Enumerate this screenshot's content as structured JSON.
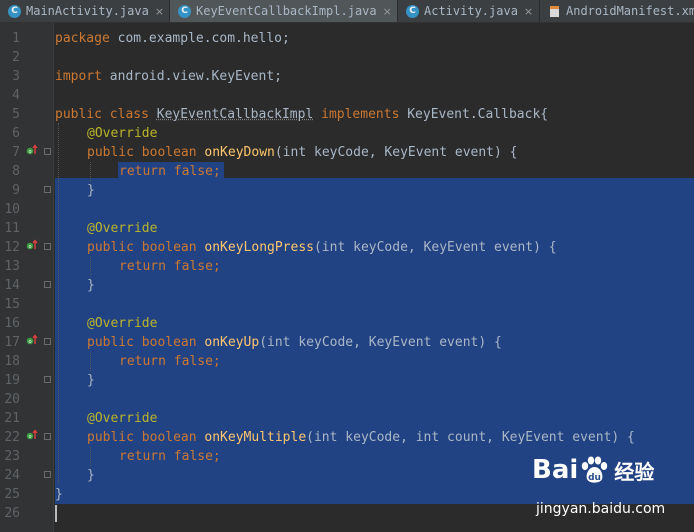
{
  "tabs": [
    {
      "label": "MainActivity.java",
      "icon": "java-class-icon",
      "icon_letter": "C",
      "active": false
    },
    {
      "label": "KeyEventCallbackImpl.java",
      "icon": "java-class-icon",
      "icon_letter": "C",
      "active": true
    },
    {
      "label": "Activity.java",
      "icon": "java-class-icon",
      "icon_letter": "C",
      "active": false
    },
    {
      "label": "AndroidManifest.xm",
      "icon": "xml-file-icon",
      "icon_letter": "",
      "active": false
    }
  ],
  "tab_close_glyph": "×",
  "editor": {
    "line_numbers": [
      "1",
      "2",
      "3",
      "4",
      "5",
      "6",
      "7",
      "8",
      "9",
      "10",
      "11",
      "12",
      "13",
      "14",
      "15",
      "16",
      "17",
      "18",
      "19",
      "20",
      "21",
      "22",
      "23",
      "24",
      "25",
      "26"
    ],
    "code": {
      "package_kw": "package",
      "package_name": " com.example.com.hello;",
      "import_kw": "import",
      "import_name": " android.view.KeyEvent;",
      "class_mods": "public class ",
      "class_name": "KeyEventCallbackImpl",
      "implements_kw": " implements ",
      "class_rest": "KeyEvent.Callback{",
      "override": "@Override",
      "public_boolean": "public boolean ",
      "m1_name": "onKeyDown",
      "m1_params": "(int keyCode, KeyEvent event) {",
      "m2_name": "onKeyLongPress",
      "m2_params": "(int keyCode, KeyEvent event) {",
      "m3_name": "onKeyUp",
      "m3_params": "(int keyCode, KeyEvent event) {",
      "m4_name": "onKeyMultiple",
      "m4_params": "(int keyCode, int count, KeyEvent event) {",
      "return_false": "return false;",
      "close_brace": "}"
    }
  },
  "watermark": {
    "logo": "Bai",
    "logo_du": "du",
    "logo_cn": "经验",
    "url": "jingyan.baidu.com"
  },
  "colors": {
    "keyword": "#cc7832",
    "annotation": "#bbb529",
    "method": "#ffc66d",
    "text": "#a9b7c6",
    "selection": "#214283",
    "background": "#2b2b2b"
  }
}
